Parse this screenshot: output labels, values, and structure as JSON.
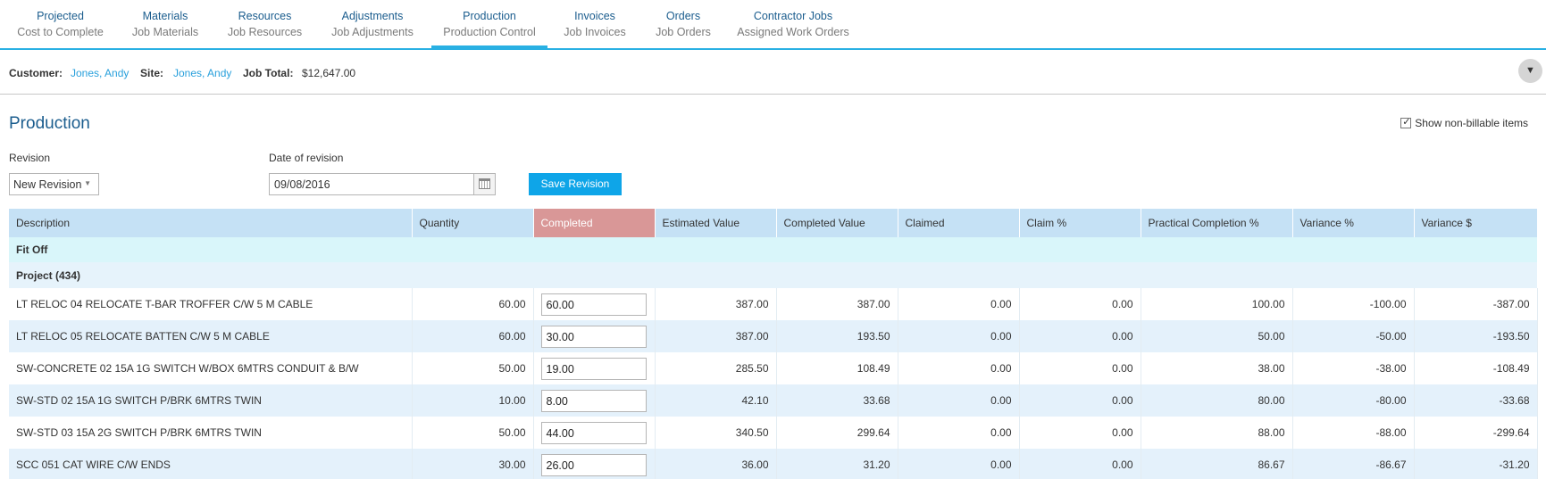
{
  "tabs": [
    {
      "label": "Projected",
      "sub": "Cost to Complete",
      "active": false
    },
    {
      "label": "Materials",
      "sub": "Job Materials",
      "active": false
    },
    {
      "label": "Resources",
      "sub": "Job Resources",
      "active": false
    },
    {
      "label": "Adjustments",
      "sub": "Job Adjustments",
      "active": false
    },
    {
      "label": "Production",
      "sub": "Production Control",
      "active": true
    },
    {
      "label": "Invoices",
      "sub": "Job Invoices",
      "active": false
    },
    {
      "label": "Orders",
      "sub": "Job Orders",
      "active": false
    },
    {
      "label": "Contractor Jobs",
      "sub": "Assigned Work Orders",
      "active": false
    }
  ],
  "info": {
    "customer_label": "Customer:",
    "customer": "Jones, Andy",
    "site_label": "Site:",
    "site": "Jones, Andy",
    "total_label": "Job Total:",
    "total": "$12,647.00"
  },
  "page": {
    "title": "Production",
    "show_nonbillable": "Show non-billable items",
    "revision_label": "Revision",
    "revision_value": "New Revision",
    "date_label": "Date of revision",
    "date_value": "09/08/2016",
    "save_label": "Save Revision"
  },
  "table": {
    "headers": [
      "Description",
      "Quantity",
      "Completed",
      "Estimated Value",
      "Completed Value",
      "Claimed",
      "Claim %",
      "Practical Completion %",
      "Variance %",
      "Variance $"
    ],
    "group": "Fit Off",
    "subgroup": "Project (434)",
    "rows": [
      [
        "LT RELOC 04 RELOCATE T-BAR TROFFER C/W 5 M CABLE",
        "60.00",
        "60.00",
        "387.00",
        "387.00",
        "0.00",
        "0.00",
        "100.00",
        "-100.00",
        "-387.00"
      ],
      [
        "LT RELOC 05 RELOCATE BATTEN C/W 5 M CABLE",
        "60.00",
        "30.00",
        "387.00",
        "193.50",
        "0.00",
        "0.00",
        "50.00",
        "-50.00",
        "-193.50"
      ],
      [
        "SW-CONCRETE 02 15A 1G SWITCH W/BOX 6MTRS CONDUIT & B/W",
        "50.00",
        "19.00",
        "285.50",
        "108.49",
        "0.00",
        "0.00",
        "38.00",
        "-38.00",
        "-108.49"
      ],
      [
        "SW-STD 02 15A 1G SWITCH P/BRK 6MTRS TWIN",
        "10.00",
        "8.00",
        "42.10",
        "33.68",
        "0.00",
        "0.00",
        "80.00",
        "-80.00",
        "-33.68"
      ],
      [
        "SW-STD 03 15A 2G SWITCH P/BRK 6MTRS TWIN",
        "50.00",
        "44.00",
        "340.50",
        "299.64",
        "0.00",
        "0.00",
        "88.00",
        "-88.00",
        "-299.64"
      ],
      [
        "SCC 051 CAT WIRE C/W ENDS",
        "30.00",
        "26.00",
        "36.00",
        "31.20",
        "0.00",
        "0.00",
        "86.67",
        "-86.67",
        "-31.20"
      ]
    ]
  }
}
